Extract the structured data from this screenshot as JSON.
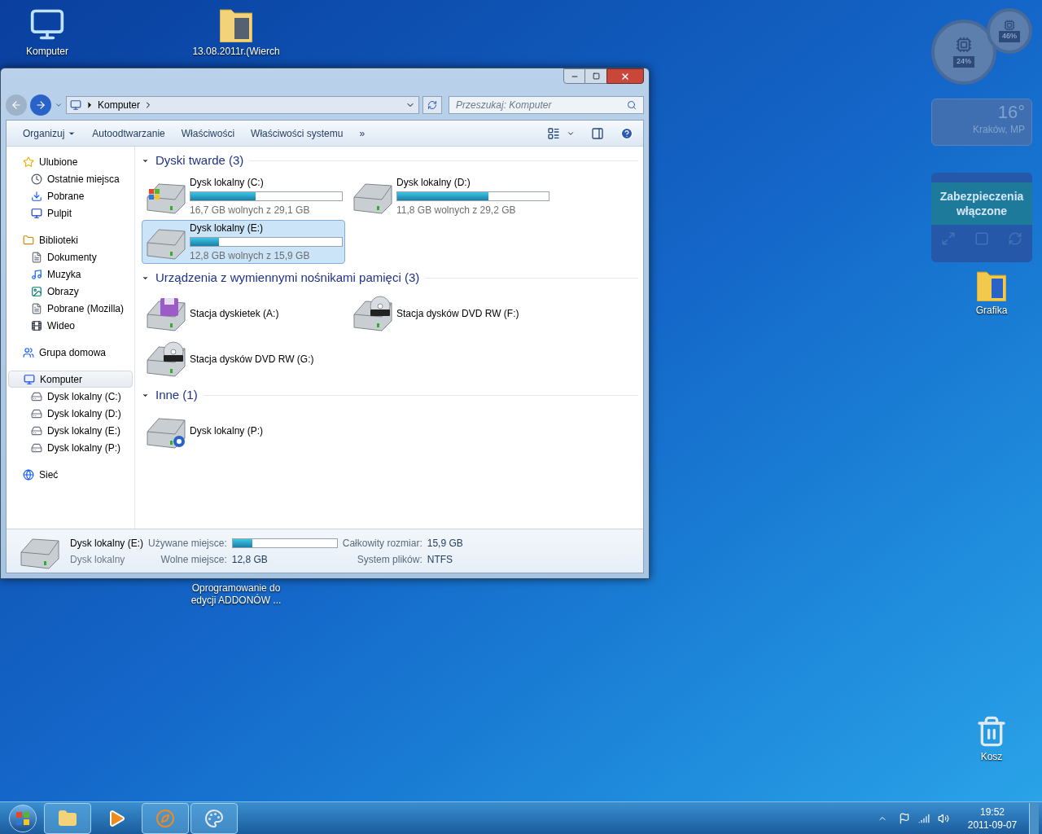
{
  "desktop_icons": [
    {
      "label": "Komputer",
      "kind": "computer"
    },
    {
      "label": "13.08.2011r.(Wierch",
      "kind": "photo-folder"
    },
    {
      "label": "Oprogramowanie do edycji ADDONÓW ...",
      "kind": "hidden"
    },
    {
      "label": "Grafika",
      "kind": "folder"
    },
    {
      "label": "Kosz",
      "kind": "recycle"
    }
  ],
  "gadgets": {
    "meter": {
      "readings": [
        "24%",
        "46%"
      ]
    },
    "weather": {
      "temperature": "16°",
      "place": "Kraków, MP"
    },
    "security": {
      "status": "Zabezpieczenia włączone"
    }
  },
  "window": {
    "address": [
      "Komputer"
    ],
    "search": {
      "placeholder": "Przeszukaj: Komputer"
    },
    "toolbar": [
      {
        "label": "Organizuj",
        "kind": "menu"
      },
      {
        "label": "Autoodtwarzanie",
        "kind": "plain"
      },
      {
        "label": "Właściwości",
        "kind": "plain"
      },
      {
        "label": "Właściwości systemu",
        "kind": "plain"
      },
      {
        "label": "»",
        "kind": "plain"
      }
    ],
    "sidebar": [
      {
        "label": "Ulubione",
        "kind": "star",
        "selected": false,
        "children": [
          {
            "label": "Ostatnie miejsca",
            "kind": "recent",
            "selected": false
          },
          {
            "label": "Pobrane",
            "kind": "download",
            "selected": false
          },
          {
            "label": "Pulpit",
            "kind": "desktop",
            "selected": false
          }
        ]
      },
      {
        "label": "Biblioteki",
        "kind": "library",
        "selected": false,
        "children": [
          {
            "label": "Dokumenty",
            "kind": "document",
            "selected": false
          },
          {
            "label": "Muzyka",
            "kind": "music",
            "selected": false
          },
          {
            "label": "Obrazy",
            "kind": "picture",
            "selected": false
          },
          {
            "label": "Pobrane (Mozilla)",
            "kind": "document",
            "selected": false
          },
          {
            "label": "Wideo",
            "kind": "video",
            "selected": false
          }
        ]
      },
      {
        "label": "Grupa domowa",
        "kind": "homegroup",
        "selected": false
      },
      {
        "label": "Komputer",
        "kind": "computer",
        "selected": true,
        "children": [
          {
            "label": "Dysk lokalny (C:)",
            "kind": "drive",
            "selected": false
          },
          {
            "label": "Dysk lokalny (D:)",
            "kind": "drive",
            "selected": false
          },
          {
            "label": "Dysk lokalny (E:)",
            "kind": "drive",
            "selected": false
          },
          {
            "label": "Dysk lokalny (P:)",
            "kind": "drive",
            "selected": false
          }
        ]
      },
      {
        "label": "Sieć",
        "kind": "network",
        "selected": false
      }
    ],
    "groups": [
      {
        "title": "Dyski twarde (3)",
        "items": [
          {
            "kind": "system",
            "name": "Dysk lokalny (C:)",
            "level": 0.43,
            "free": "16,7 GB wolnych z 29,1 GB",
            "selected": false
          },
          {
            "kind": "hdd",
            "name": "Dysk lokalny (D:)",
            "level": 0.6,
            "free": "11,8 GB wolnych z 29,2 GB",
            "selected": false
          },
          {
            "kind": "hdd",
            "name": "Dysk lokalny (E:)",
            "level": 0.19,
            "free": "12,8 GB wolnych z 15,9 GB",
            "selected": true
          }
        ]
      },
      {
        "title": "Urządzenia z wymiennymi nośnikami pamięci (3)",
        "items": [
          {
            "kind": "floppy",
            "name": "Stacja dyskietek (A:)",
            "selected": false
          },
          {
            "kind": "dvd",
            "name": "Stacja dysków DVD RW (F:)",
            "selected": false
          },
          {
            "kind": "dvd",
            "name": "Stacja dysków DVD RW (G:)",
            "selected": false
          }
        ]
      },
      {
        "title": "Inne (1)",
        "items": [
          {
            "kind": "unknown",
            "name": "Dysk lokalny (P:)",
            "selected": false
          }
        ]
      }
    ],
    "details": {
      "name": "Dysk lokalny (E:)",
      "type": "Dysk lokalny",
      "fields": [
        {
          "label": "Używane miejsce:",
          "kind": "bar",
          "level": 0.19
        },
        {
          "label": "Całkowity rozmiar:",
          "kind": "text",
          "value": "15,9 GB"
        },
        {
          "label": "Wolne miejsce:",
          "kind": "text",
          "value": "12,8 GB"
        },
        {
          "label": "System plików:",
          "kind": "text",
          "value": "NTFS"
        }
      ]
    }
  },
  "taskbar": {
    "buttons": [
      {
        "kind": "explorer",
        "active": true
      },
      {
        "kind": "media",
        "active": false
      },
      {
        "kind": "firefox",
        "active": true
      },
      {
        "kind": "paint",
        "active": true
      }
    ],
    "clock": {
      "time": "19:52",
      "date": "2011-09-07"
    }
  }
}
